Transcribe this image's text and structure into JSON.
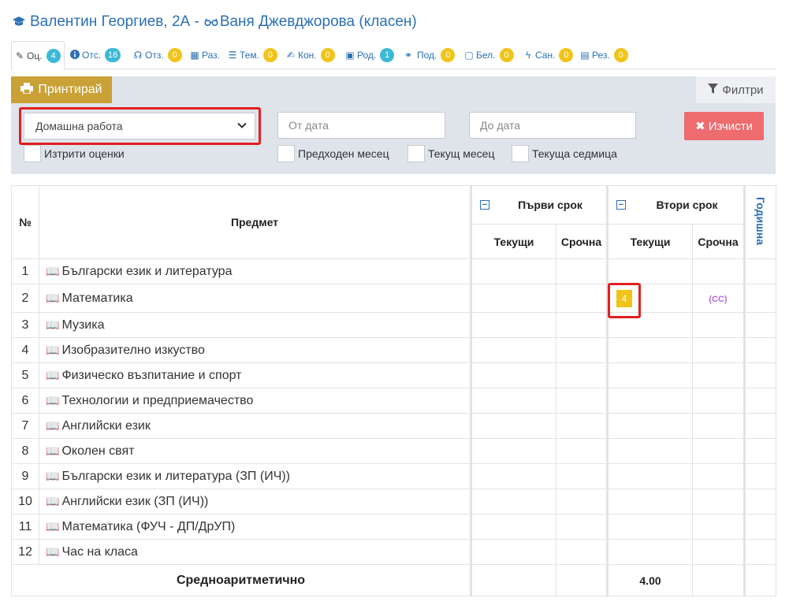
{
  "header": {
    "student": "Валентин Георгиев, 2А -",
    "teacher": "Ваня Джевджорова (класен)"
  },
  "tabs": [
    {
      "label": "Оц.",
      "icon": "pencil-icon",
      "count": "4",
      "color": "#3cb9d6"
    },
    {
      "label": "Отс.",
      "icon": "info-icon",
      "count": "16",
      "color": "#3cb9d6"
    },
    {
      "label": "Отз.",
      "icon": "ribbon-icon",
      "count": "0",
      "color": "#f0c419"
    },
    {
      "label": "Раз.",
      "icon": "table-icon",
      "count": "",
      "color": ""
    },
    {
      "label": "Тем.",
      "icon": "list-icon",
      "count": "0",
      "color": "#f0c419"
    },
    {
      "label": "Кон.",
      "icon": "edit-icon",
      "count": "0",
      "color": "#f0c419"
    },
    {
      "label": "Род.",
      "icon": "calendar-icon",
      "count": "1",
      "color": "#3cb9d6"
    },
    {
      "label": "Под.",
      "icon": "handshake-icon",
      "count": "0",
      "color": "#f0c419"
    },
    {
      "label": "Бел.",
      "icon": "note-icon",
      "count": "0",
      "color": "#f0c419"
    },
    {
      "label": "Сан.",
      "icon": "bolt-icon",
      "count": "0",
      "color": "#f0c419"
    },
    {
      "label": "Рез.",
      "icon": "document-icon",
      "count": "0",
      "color": "#f0c419"
    }
  ],
  "toolbar": {
    "print_label": "Принтирай",
    "filters_label": "Филтри",
    "clear_label": "Изчисти"
  },
  "filters": {
    "grade_type": "Домашна работа",
    "from_placeholder": "От дата",
    "to_placeholder": "До дата",
    "deleted_grades": "Изтрити оценки",
    "previous_month": "Предходен месец",
    "current_month": "Текущ месец",
    "current_week": "Текуща седмица"
  },
  "table": {
    "col_no": "№",
    "col_subject": "Предмет",
    "term1": "Първи срок",
    "term2": "Втори срок",
    "current": "Текущи",
    "final": "Срочна",
    "annual": "Годишна",
    "average_label": "Средноаритметично",
    "average_value": "4.00",
    "rows": [
      {
        "no": "1",
        "subject": "Български език и литература"
      },
      {
        "no": "2",
        "subject": "Математика",
        "t2_current": "4",
        "t2_final": "(СС)"
      },
      {
        "no": "3",
        "subject": "Музика"
      },
      {
        "no": "4",
        "subject": "Изобразително изкуство"
      },
      {
        "no": "5",
        "subject": "Физическо възпитание и спорт"
      },
      {
        "no": "6",
        "subject": "Технологии и предприемачество"
      },
      {
        "no": "7",
        "subject": "Английски език"
      },
      {
        "no": "8",
        "subject": "Околен свят"
      },
      {
        "no": "9",
        "subject": "Български език и литература (ЗП (ИЧ))"
      },
      {
        "no": "10",
        "subject": "Английски език (ЗП (ИЧ))"
      },
      {
        "no": "11",
        "subject": "Математика (ФУЧ - ДП/ДрУП)"
      },
      {
        "no": "12",
        "subject": "Час на класа"
      }
    ]
  }
}
